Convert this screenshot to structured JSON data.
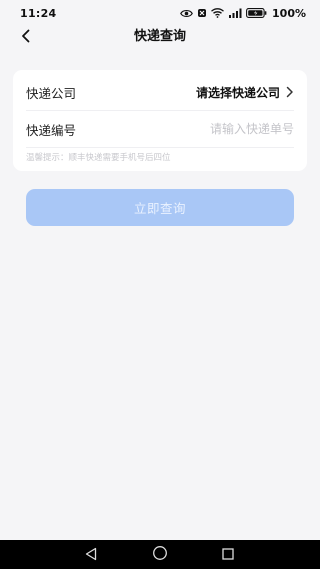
{
  "status_bar": {
    "time": "11:24",
    "battery": "100%",
    "icons": [
      "eye-icon",
      "alarm-icon",
      "wifi-icon",
      "cellular-signal-icon",
      "battery-icon"
    ]
  },
  "header": {
    "back_icon": "chevron-left-icon",
    "title": "快递查询"
  },
  "form": {
    "company_label": "快递公司",
    "company_value": "请选择快递公司",
    "company_arrow_icon": "chevron-right-icon",
    "number_label": "快递编号",
    "number_value": "",
    "number_placeholder": "请输入快递单号",
    "tip": "温馨提示：顺丰快递需要手机号后四位"
  },
  "actions": {
    "query_label": "立即查询",
    "query_color": "#a9c7f6"
  },
  "system_nav": {
    "icons": [
      "back-triangle-icon",
      "home-circle-icon",
      "recents-square-icon"
    ]
  },
  "colors": {
    "background": "#f5f5f7",
    "card": "#ffffff",
    "placeholder": "#c4c4c9"
  }
}
